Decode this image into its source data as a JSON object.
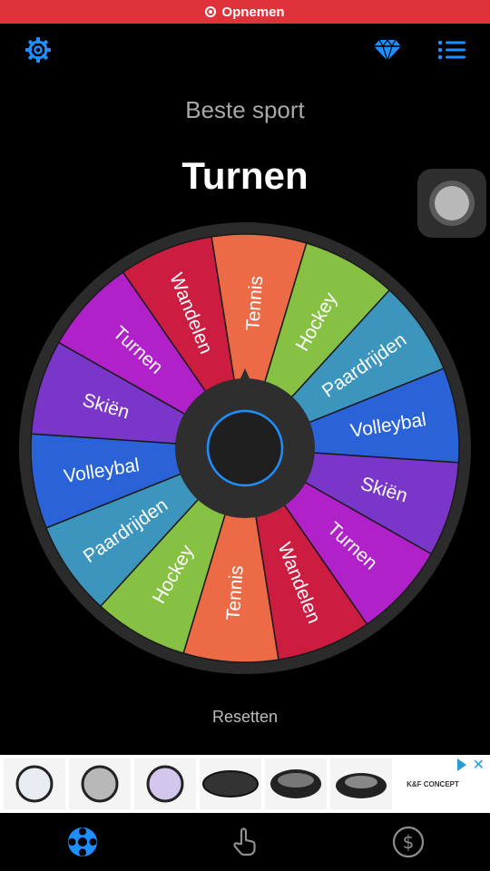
{
  "status_bar": {
    "recording_label": "Opnemen"
  },
  "header": {
    "icons": [
      "gear-icon",
      "diamond-icon",
      "list-icon"
    ],
    "accent_color": "#1e8fff"
  },
  "wheel": {
    "title": "Beste sport",
    "result": "Turnen",
    "segments": [
      {
        "label": "Tennis",
        "color": "#ec6a45"
      },
      {
        "label": "Hockey",
        "color": "#86c143"
      },
      {
        "label": "Paardrijden",
        "color": "#3c95bd"
      },
      {
        "label": "Volleybal",
        "color": "#2a63d8"
      },
      {
        "label": "Skiën",
        "color": "#7a36c9"
      },
      {
        "label": "Turnen",
        "color": "#b121c9"
      },
      {
        "label": "Wandelen",
        "color": "#cc1c3f"
      },
      {
        "label": "Tennis",
        "color": "#ec6a45"
      },
      {
        "label": "Hockey",
        "color": "#86c143"
      },
      {
        "label": "Paardrijden",
        "color": "#3c95bd"
      },
      {
        "label": "Volleybal",
        "color": "#2a63d8"
      },
      {
        "label": "Skiën",
        "color": "#7a36c9"
      },
      {
        "label": "Turnen",
        "color": "#b121c9"
      },
      {
        "label": "Wandelen",
        "color": "#cc1c3f"
      }
    ],
    "rotation_deg": -9,
    "reset_label": "Resetten"
  },
  "ad": {
    "brand": "K&F CONCEPT"
  },
  "tabbar": {
    "tabs": [
      "wheel-icon",
      "touch-icon",
      "dollar-icon"
    ],
    "active_color": "#1e8fff",
    "inactive_color": "#8e8e8e"
  }
}
